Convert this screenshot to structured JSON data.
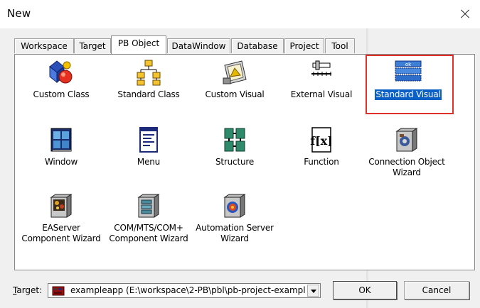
{
  "window": {
    "title": "New"
  },
  "tabs": [
    "Workspace",
    "Target",
    "PB Object",
    "DataWindow",
    "Database",
    "Project",
    "Tool"
  ],
  "active_tab": "PB Object",
  "items": [
    {
      "label": "Custom Class",
      "icon": "custom-class-icon"
    },
    {
      "label": "Standard Class",
      "icon": "standard-class-icon"
    },
    {
      "label": "Custom Visual",
      "icon": "custom-visual-icon"
    },
    {
      "label": "External Visual",
      "icon": "external-visual-icon"
    },
    {
      "label": "Standard Visual",
      "icon": "standard-visual-icon",
      "selected": true
    },
    {
      "label": "Window",
      "icon": "window-icon"
    },
    {
      "label": "Menu",
      "icon": "menu-icon"
    },
    {
      "label": "Structure",
      "icon": "structure-icon"
    },
    {
      "label": "Function",
      "icon": "function-icon"
    },
    {
      "label_lines": [
        "Connection Object",
        "Wizard"
      ],
      "icon": "connection-object-wizard-icon"
    },
    {
      "label_lines": [
        "EAServer",
        "Component Wizard"
      ],
      "icon": "easerver-component-wizard-icon"
    },
    {
      "label_lines": [
        "COM/MTS/COM+",
        "Component Wizard"
      ],
      "icon": "com-component-wizard-icon"
    },
    {
      "label_lines": [
        "Automation Server",
        "Wizard"
      ],
      "icon": "automation-server-wizard-icon"
    }
  ],
  "bottom": {
    "target_label": "Target:",
    "target_value": "exampleapp (E:\\workspace\\2-PB\\pbl\\pb-project-exampl",
    "ok_label": "OK",
    "cancel_label": "Cancel"
  },
  "colors": {
    "selection": "#0a60c4",
    "highlight_border": "#e0302a"
  }
}
